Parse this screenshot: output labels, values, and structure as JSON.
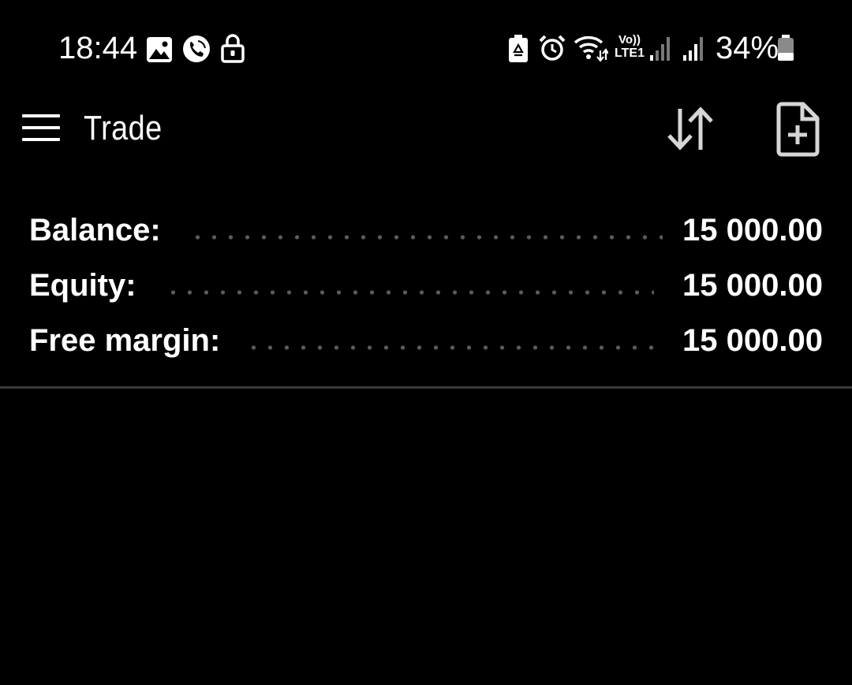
{
  "status_bar": {
    "time": "18:44",
    "battery_percent": "34%",
    "battery_level": 0.34,
    "left_icons": [
      "gallery-icon",
      "viber-icon",
      "lock-icon"
    ],
    "right_icons": [
      "battery-saver-icon",
      "alarm-icon",
      "wifi-icon",
      "volte-icon",
      "signal-weak-icon",
      "signal-icon",
      "battery-icon"
    ],
    "volte_top": "Vo))",
    "volte_bottom": "LTE1"
  },
  "app_bar": {
    "title": "Trade",
    "menu_icon": "hamburger-menu-icon",
    "sort_icon": "sort-arrows-icon",
    "new_order_icon": "file-plus-icon"
  },
  "account": {
    "rows": [
      {
        "label": "Balance:",
        "value": "15 000.00"
      },
      {
        "label": "Equity:",
        "value": "15 000.00"
      },
      {
        "label": "Free margin:",
        "value": "15 000.00"
      }
    ]
  },
  "colors": {
    "background": "#000000",
    "text": "#ffffff",
    "leader_dots": "#5b5b5b",
    "divider": "#3a3a3a"
  }
}
